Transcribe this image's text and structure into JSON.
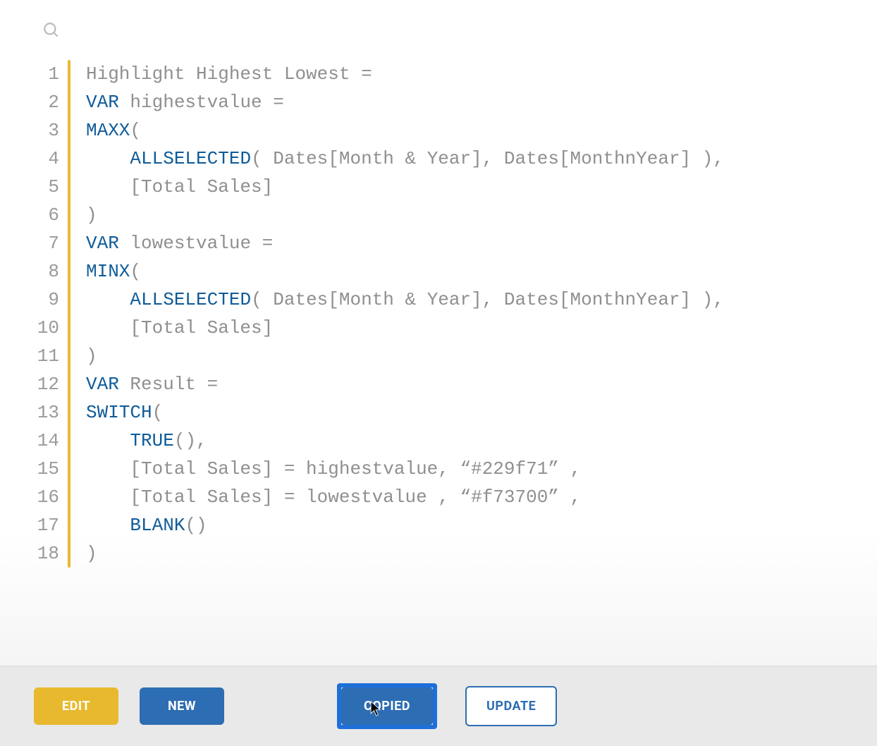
{
  "code": {
    "lines": [
      {
        "num": "1",
        "tokens": [
          {
            "t": "Highlight Highest Lowest =",
            "c": "tok-plain"
          }
        ]
      },
      {
        "num": "2",
        "tokens": [
          {
            "t": "VAR",
            "c": "tok-keyword"
          },
          {
            "t": " highestvalue =",
            "c": "tok-plain"
          }
        ]
      },
      {
        "num": "3",
        "tokens": [
          {
            "t": "MAXX",
            "c": "tok-func"
          },
          {
            "t": "(",
            "c": "tok-plain"
          }
        ]
      },
      {
        "num": "4",
        "tokens": [
          {
            "t": "    ",
            "c": "tok-plain"
          },
          {
            "t": "ALLSELECTED",
            "c": "tok-func"
          },
          {
            "t": "( Dates[Month & Year], Dates[MonthnYear] ),",
            "c": "tok-plain"
          }
        ]
      },
      {
        "num": "5",
        "tokens": [
          {
            "t": "    [Total Sales]",
            "c": "tok-plain"
          }
        ]
      },
      {
        "num": "6",
        "tokens": [
          {
            "t": ")",
            "c": "tok-plain"
          }
        ]
      },
      {
        "num": "7",
        "tokens": [
          {
            "t": "VAR",
            "c": "tok-keyword"
          },
          {
            "t": " lowestvalue =",
            "c": "tok-plain"
          }
        ]
      },
      {
        "num": "8",
        "tokens": [
          {
            "t": "MINX",
            "c": "tok-func"
          },
          {
            "t": "(",
            "c": "tok-plain"
          }
        ]
      },
      {
        "num": "9",
        "tokens": [
          {
            "t": "    ",
            "c": "tok-plain"
          },
          {
            "t": "ALLSELECTED",
            "c": "tok-func"
          },
          {
            "t": "( Dates[Month & Year], Dates[MonthnYear] ),",
            "c": "tok-plain"
          }
        ]
      },
      {
        "num": "10",
        "tokens": [
          {
            "t": "    [Total Sales]",
            "c": "tok-plain"
          }
        ]
      },
      {
        "num": "11",
        "tokens": [
          {
            "t": ")",
            "c": "tok-plain"
          }
        ]
      },
      {
        "num": "12",
        "tokens": [
          {
            "t": "VAR",
            "c": "tok-keyword"
          },
          {
            "t": " Result =",
            "c": "tok-plain"
          }
        ]
      },
      {
        "num": "13",
        "tokens": [
          {
            "t": "SWITCH",
            "c": "tok-func"
          },
          {
            "t": "(",
            "c": "tok-plain"
          }
        ]
      },
      {
        "num": "14",
        "tokens": [
          {
            "t": "    ",
            "c": "tok-plain"
          },
          {
            "t": "TRUE",
            "c": "tok-func"
          },
          {
            "t": "(),",
            "c": "tok-plain"
          }
        ]
      },
      {
        "num": "15",
        "tokens": [
          {
            "t": "    [Total Sales] = highestvalue, “#229f71” ,",
            "c": "tok-plain"
          }
        ]
      },
      {
        "num": "16",
        "tokens": [
          {
            "t": "    [Total Sales] = lowestvalue , “#f73700” ,",
            "c": "tok-plain"
          }
        ]
      },
      {
        "num": "17",
        "tokens": [
          {
            "t": "    ",
            "c": "tok-plain"
          },
          {
            "t": "BLANK",
            "c": "tok-func"
          },
          {
            "t": "()",
            "c": "tok-plain"
          }
        ]
      },
      {
        "num": "18",
        "tokens": [
          {
            "t": ")",
            "c": "tok-plain"
          }
        ]
      }
    ]
  },
  "buttons": {
    "edit": "EDIT",
    "new": "NEW",
    "copied": "COPIED",
    "update": "UPDATE"
  }
}
